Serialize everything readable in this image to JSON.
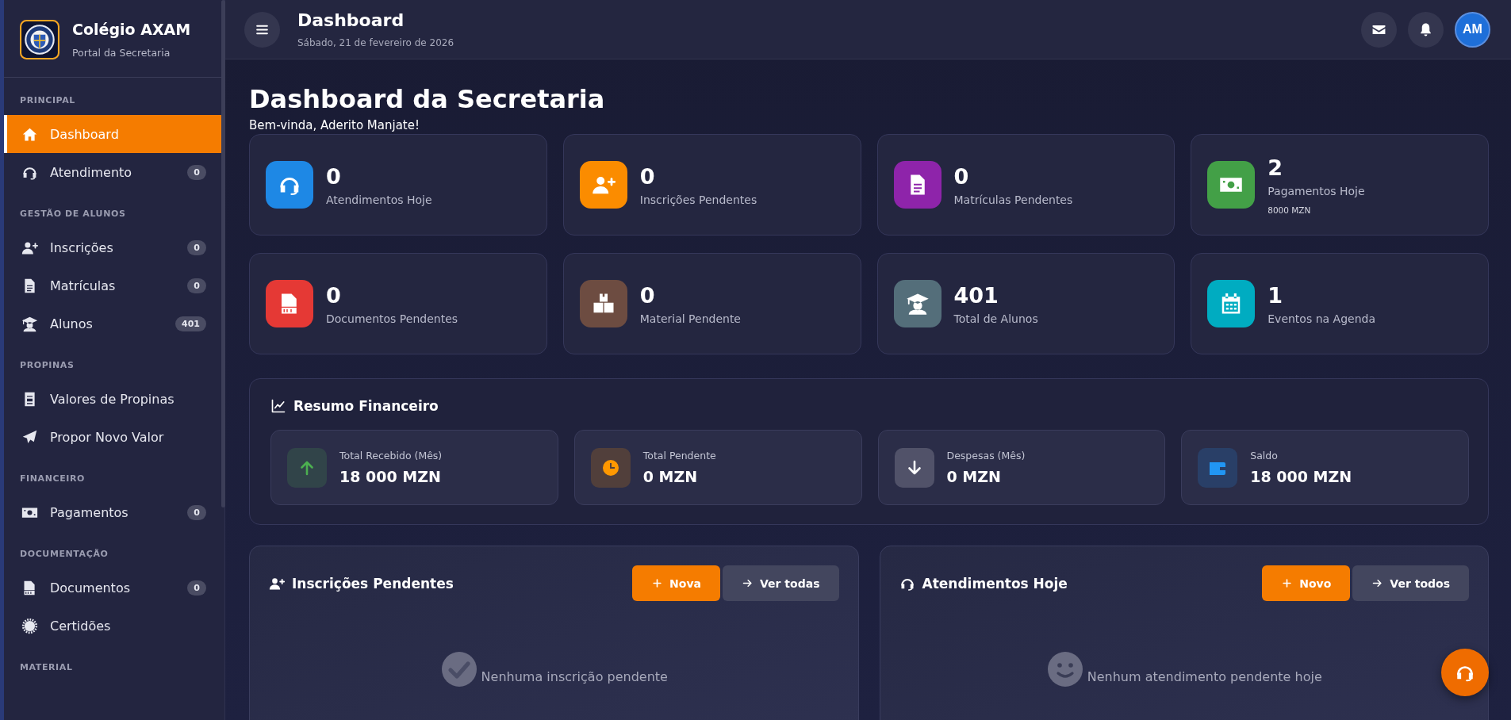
{
  "sidebar": {
    "brand": {
      "name": "Colégio AXAM",
      "subtitle": "Portal da Secretaria"
    },
    "sections": [
      {
        "title": "PRINCIPAL",
        "items": [
          {
            "label": "Dashboard",
            "selected": true
          },
          {
            "label": "Atendimento",
            "selected": false,
            "badge": "0"
          }
        ]
      },
      {
        "title": "GESTÃO DE ALUNOS",
        "items": [
          {
            "label": "Inscrições",
            "selected": false,
            "badge": "0"
          },
          {
            "label": "Matrículas",
            "selected": false,
            "badge": "0"
          },
          {
            "label": "Alunos",
            "selected": false,
            "badge": "401"
          }
        ]
      },
      {
        "title": "PROPINAS",
        "items": [
          {
            "label": "Valores de Propinas",
            "selected": false
          },
          {
            "label": "Propor Novo Valor",
            "selected": false
          }
        ]
      },
      {
        "title": "FINANCEIRO",
        "items": [
          {
            "label": "Pagamentos",
            "selected": false,
            "badge": "0"
          }
        ]
      },
      {
        "title": "DOCUMENTAÇÃO",
        "items": [
          {
            "label": "Documentos",
            "selected": false,
            "badge": "0"
          },
          {
            "label": "Certidões",
            "selected": false
          }
        ]
      },
      {
        "title": "MATERIAL"
      }
    ]
  },
  "header": {
    "title": "Dashboard",
    "date": "Sábado, 21 de fevereiro de 2026",
    "avatar": "AM"
  },
  "page": {
    "title": "Dashboard da Secretaria",
    "welcome": "Bem-vinda, Aderito Manjate!"
  },
  "stats": [
    {
      "value": "0",
      "label": "Atendimentos Hoje",
      "color": "#1e88e5"
    },
    {
      "value": "0",
      "label": "Inscrições Pendentes",
      "color": "#fb8c00"
    },
    {
      "value": "0",
      "label": "Matrículas Pendentes",
      "color": "#8e24aa"
    },
    {
      "value": "2",
      "label": "Pagamentos Hoje",
      "note": "8000 MZN",
      "color": "#43a047"
    },
    {
      "value": "0",
      "label": "Documentos Pendentes",
      "color": "#e53935"
    },
    {
      "value": "0",
      "label": "Material Pendente",
      "color": "#6d4c41"
    },
    {
      "value": "401",
      "label": "Total de Alunos",
      "color": "#546e7a"
    },
    {
      "value": "1",
      "label": "Eventos na Agenda",
      "color": "#00acc1"
    }
  ],
  "finance": {
    "title": "Resumo Financeiro",
    "items": [
      {
        "label": "Total Recebido (Mês)",
        "value": "18 000 MZN",
        "color": "#4caf50"
      },
      {
        "label": "Total Pendente",
        "value": "0 MZN",
        "color": "#ff9800"
      },
      {
        "label": "Despesas (Mês)",
        "value": "0 MZN",
        "color": "#ffffff"
      },
      {
        "label": "Saldo",
        "value": "18 000 MZN",
        "color": "#2196f3"
      }
    ]
  },
  "panels": [
    {
      "title": "Inscrições Pendentes",
      "new_button": "Nova",
      "view_button": "Ver todas",
      "empty": "Nenhuma inscrição pendente"
    },
    {
      "title": "Atendimentos Hoje",
      "new_button": "Novo",
      "view_button": "Ver todos",
      "empty": "Nenhum atendimento pendente hoje"
    }
  ]
}
